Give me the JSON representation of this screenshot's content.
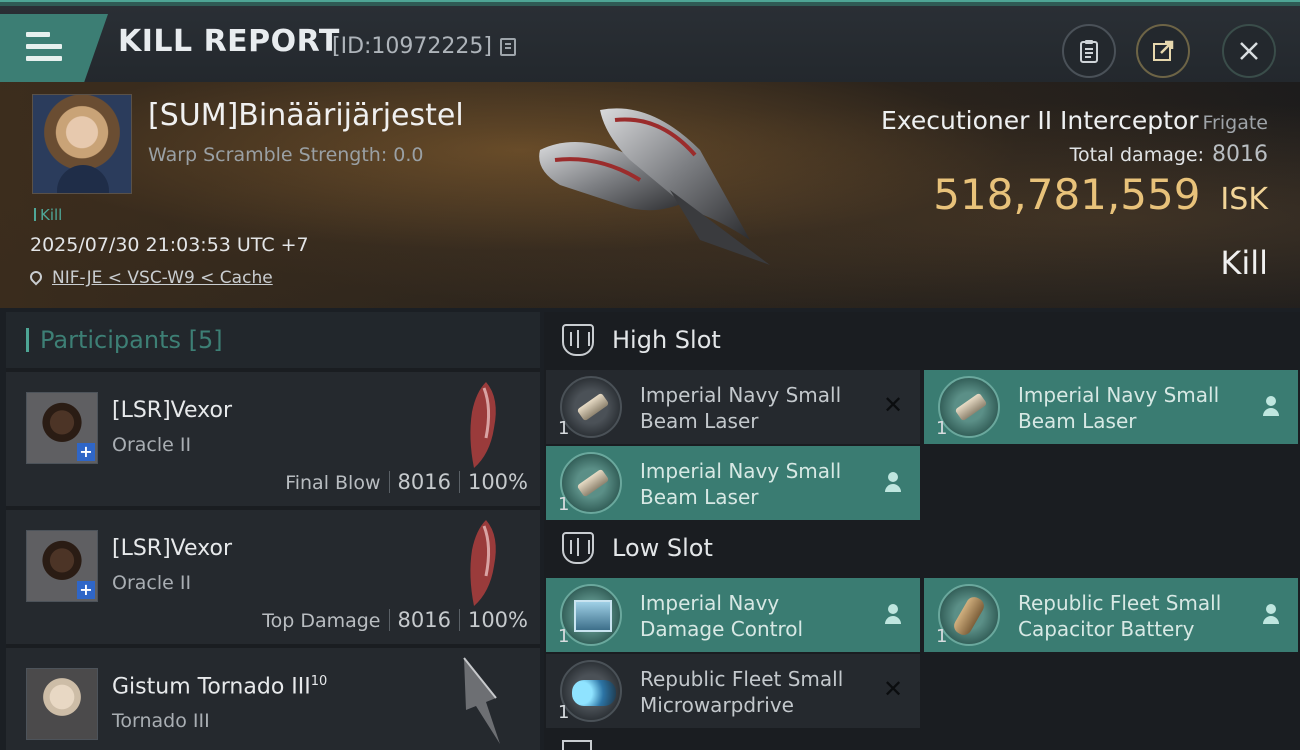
{
  "header": {
    "title": "KILL REPORT",
    "report_id": "[ID:10972225]",
    "menu_icon": "hamburger-menu-icon",
    "clipboard_icon": "clipboard-icon",
    "share_icon": "share-external-icon",
    "close_icon": "close-icon"
  },
  "victim": {
    "name": "[SUM]Binäärijärjestel",
    "warp_scramble": "Warp Scramble Strength: 0.0",
    "kill_tag": "Kill",
    "datetime": "2025/07/30 21:03:53 UTC +7",
    "location": "NIF-JE < VSC-W9 < Cache",
    "ship_name": "Executioner II Interceptor",
    "ship_class": "Frigate",
    "total_damage_label": "Total damage:",
    "total_damage": "8016",
    "isk_value": "518,781,559",
    "isk_unit": "ISK",
    "result": "Kill"
  },
  "participants": {
    "title": "Participants",
    "count": "[5]",
    "rows": [
      {
        "name": "[LSR]Vexor",
        "ship": "Oracle II",
        "role": "Final Blow",
        "damage": "8016",
        "percent": "100%"
      },
      {
        "name": "[LSR]Vexor",
        "ship": "Oracle II",
        "role": "Top Damage",
        "damage": "8016",
        "percent": "100%"
      },
      {
        "name": "Gistum Tornado III",
        "name_sup": "10",
        "ship": "Tornado III"
      }
    ]
  },
  "fitting": {
    "high_slot_label": "High Slot",
    "low_slot_label": "Low Slot",
    "high": [
      {
        "line1": "Imperial Navy Small",
        "line2": "Beam Laser",
        "qty": "1",
        "state": "destroyed"
      },
      {
        "line1": "Imperial Navy Small",
        "line2": "Beam Laser",
        "qty": "1",
        "state": "dropped"
      },
      {
        "line1": "Imperial Navy Small",
        "line2": "Beam Laser",
        "qty": "1",
        "state": "dropped"
      }
    ],
    "low": [
      {
        "line1": "Imperial Navy",
        "line2": "Damage Control",
        "qty": "1",
        "state": "dropped"
      },
      {
        "line1": "Republic Fleet Small",
        "line2": "Capacitor Battery",
        "qty": "1",
        "state": "dropped"
      },
      {
        "line1": "Republic Fleet Small",
        "line2": "Microwarpdrive",
        "qty": "1",
        "state": "destroyed"
      }
    ],
    "destroyed_mark": "✕"
  },
  "colors": {
    "accent": "#4ea595",
    "isk_gold": "#e8c27a",
    "dropped_bg": "#3a7c72",
    "destroyed_bg": "#25292e"
  }
}
